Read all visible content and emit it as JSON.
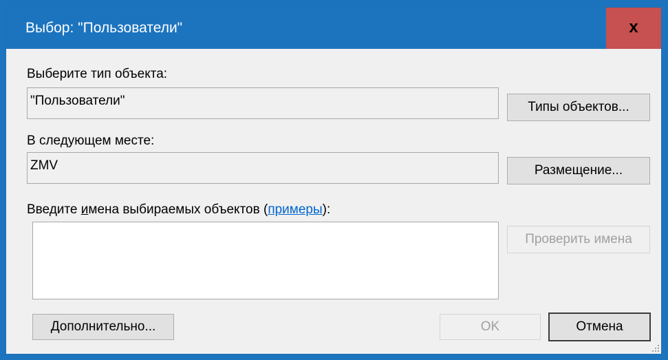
{
  "window": {
    "title": "Выбор: \"Пользователи\"",
    "close_glyph": "x"
  },
  "object_type": {
    "label": "Выберите тип объекта:",
    "value": "\"Пользователи\"",
    "button": "Типы объектов..."
  },
  "location": {
    "label": "В следующем месте:",
    "value": "ZMV",
    "button": "Размещение..."
  },
  "names": {
    "label_prefix": "Введите ",
    "label_accel": "и",
    "label_mid": "мена выбираемых объектов (",
    "link": "примеры",
    "label_suffix": "):",
    "value": "",
    "check_button": "Проверить имена"
  },
  "footer": {
    "advanced_button": "Дополнительно...",
    "ok_button": "OK",
    "cancel_button": "Отмена"
  },
  "colors": {
    "titlebar": "#1c74bf",
    "close_button": "#c75050",
    "dialog_bg": "#f0f0f0",
    "link": "#0066cc"
  }
}
